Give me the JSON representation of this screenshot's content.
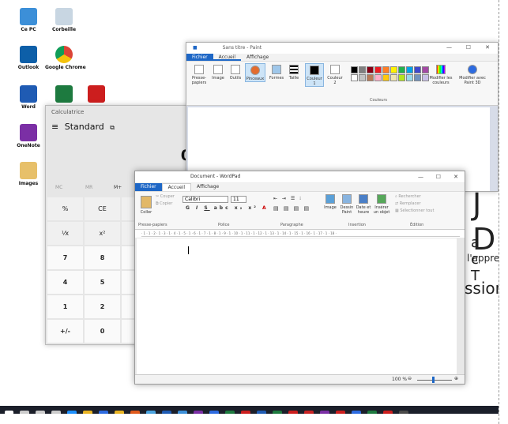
{
  "desktop": {
    "icons": [
      {
        "label": "Ce PC",
        "color": "#3c8fd8"
      },
      {
        "label": "Corbeille",
        "color": "#c8d6e2"
      },
      {
        "label": "Outlook",
        "color": "#0d5fa8"
      },
      {
        "label": "Google Chrome",
        "color": "#e8b323"
      },
      {
        "label": "Word",
        "color": "#1f5bb3"
      },
      {
        "label": "",
        "color": "#1d7a3f"
      },
      {
        "label": "",
        "color": "#cc1e1e"
      },
      {
        "label": "OneNote",
        "color": "#7b2fa5"
      },
      {
        "label": "Images",
        "color": "#e7c06a"
      }
    ]
  },
  "calculator": {
    "title": "Calculatrice",
    "menu_icon": "hamburger-icon",
    "mode": "Standard",
    "display": "0",
    "memory": [
      "MC",
      "MR",
      "M+"
    ],
    "rows": [
      [
        "%",
        "CE",
        "C"
      ],
      [
        "¹⁄x",
        "x²",
        "²√x"
      ],
      [
        "7",
        "8",
        "9"
      ],
      [
        "4",
        "5",
        "6"
      ],
      [
        "1",
        "2",
        "3"
      ],
      [
        "+/-",
        "0",
        ","
      ]
    ]
  },
  "paint": {
    "title": "Sans titre - Paint",
    "tabs": [
      "Fichier",
      "Accueil",
      "Affichage"
    ],
    "buttons": [
      "Presse-papiers",
      "Image",
      "Outils",
      "Pinceaux",
      "Formes",
      "Taille",
      "Couleur 1",
      "Couleur 2",
      "Modifier les couleurs",
      "Modifier avec Paint 3D"
    ],
    "group_label": "Couleurs",
    "palette": [
      "#000000",
      "#7f7f7f",
      "#880015",
      "#ed1c24",
      "#ff7f27",
      "#fff200",
      "#22b14c",
      "#00a2e8",
      "#3f48cc",
      "#a349a4",
      "#ffffff",
      "#c3c3c3",
      "#b97a57",
      "#ffaec9",
      "#ffc90e",
      "#efe4b0",
      "#b5e61d",
      "#99d9ea",
      "#7092be",
      "#c8bfe7"
    ]
  },
  "wordpad": {
    "title": "Document - WordPad",
    "tabs": [
      "Fichier",
      "Accueil",
      "Affichage"
    ],
    "clip": [
      "Coller",
      "Couper",
      "Copier"
    ],
    "font": "Calibri",
    "size": "11",
    "insert": [
      "Image",
      "Dessin Paint",
      "Date et heure",
      "Insérer un objet"
    ],
    "edit": [
      "Rechercher",
      "Remplacer",
      "Sélectionner tout"
    ],
    "groups": [
      "Presse-papiers",
      "Police",
      "Paragraphe",
      "Insertion",
      "Édition"
    ],
    "ruler": "· 1 · 1 · 2 · 1 · 3 · 1 · 4 · 1 · 5 · 1 · 6 · 1 · 7 · 1 · 8 · 1 · 9 · 1 · 10 · 1 · 11 · 1 · 12 · 1 · 13 · 1 · 14 · 1 · 15 · 1 · 16 · 1 · 17 · 1 · 18 ·",
    "zoom": "100 %"
  },
  "background_text": {
    "big": "J D",
    "line2": "a c T",
    "line3": "l'appren",
    "line4": "ssion"
  },
  "taskbar": {
    "icons": [
      "#ffffff",
      "#cccccc",
      "#cccccc",
      "#cccccc",
      "#1e90ff",
      "#e8b323",
      "#2d6be0",
      "#e8b323",
      "#e05a1c",
      "#4aa3df",
      "#1f5bb3",
      "#3c8fd8",
      "#7b2fa5",
      "#2d6be0",
      "#1d7a3f",
      "#cc1e1e",
      "#1f5bb3",
      "#1d7a3f",
      "#cc1e1e",
      "#c82323",
      "#7b2fa5",
      "#cc1e1e",
      "#2d6be0",
      "#1d7a3f",
      "#cc1e1e",
      "#4a4a4a"
    ]
  }
}
